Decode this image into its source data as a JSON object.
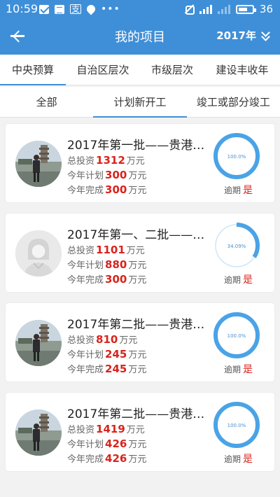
{
  "status_bar": {
    "time": "10:59",
    "sim_icon_char": "支",
    "battery_level": "36"
  },
  "header": {
    "title": "我的项目",
    "year_label": "2017年"
  },
  "tabs_primary": [
    {
      "label": "中央预算",
      "active": true
    },
    {
      "label": "自治区层次",
      "active": false
    },
    {
      "label": "市级层次",
      "active": false
    },
    {
      "label": "建设丰收年",
      "active": false
    }
  ],
  "tabs_secondary": [
    {
      "label": "全部",
      "active": false
    },
    {
      "label": "计划新开工",
      "active": true
    },
    {
      "label": "竣工或部分竣工",
      "active": false
    }
  ],
  "labels": {
    "invest_prefix": "总投资",
    "plan_prefix": "今年计划",
    "done_prefix": "今年完成",
    "unit": "万元",
    "overdue_label": "逾期"
  },
  "projects": [
    {
      "title": "2017年第一批——贵港市…",
      "invest": "1312",
      "plan": "300",
      "done": "300",
      "progress_text": "100.0%",
      "progress": 1.0,
      "overdue": "是",
      "avatar": "photo"
    },
    {
      "title": "2017年第一、二批——贵…",
      "invest": "1101",
      "plan": "880",
      "done": "300",
      "progress_text": "34.09%",
      "progress": 0.3409,
      "overdue": "是",
      "avatar": "default"
    },
    {
      "title": "2017年第二批——贵港市…",
      "invest": "810",
      "plan": "245",
      "done": "245",
      "progress_text": "100.0%",
      "progress": 1.0,
      "overdue": "是",
      "avatar": "photo"
    },
    {
      "title": "2017年第二批——贵港市…",
      "invest": "1419",
      "plan": "426",
      "done": "426",
      "progress_text": "100.0%",
      "progress": 1.0,
      "overdue": "是",
      "avatar": "photo"
    }
  ],
  "colors": {
    "primary": "#3f8fd8",
    "ring": "#4aa3e6",
    "ring_track": "#cfe6f7",
    "accent_red": "#d9231d"
  }
}
